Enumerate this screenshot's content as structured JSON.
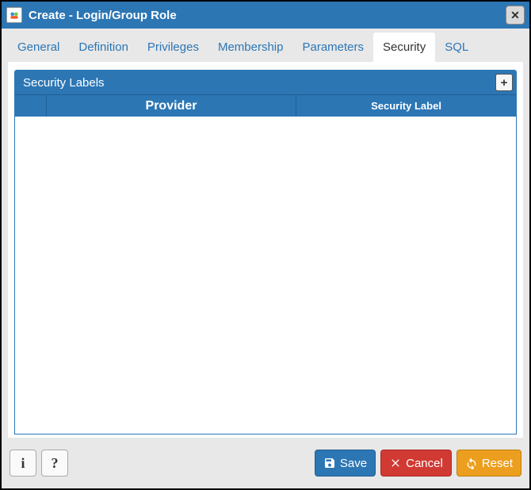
{
  "window": {
    "title": "Create - Login/Group Role"
  },
  "tabs": [
    {
      "label": "General",
      "active": false
    },
    {
      "label": "Definition",
      "active": false
    },
    {
      "label": "Privileges",
      "active": false
    },
    {
      "label": "Membership",
      "active": false
    },
    {
      "label": "Parameters",
      "active": false
    },
    {
      "label": "Security",
      "active": true
    },
    {
      "label": "SQL",
      "active": false
    }
  ],
  "panel": {
    "title": "Security Labels",
    "add_tooltip": "+",
    "columns": [
      "",
      "Provider",
      "Security Label"
    ],
    "rows": []
  },
  "footer": {
    "info": "i",
    "help": "?",
    "save": "Save",
    "cancel": "Cancel",
    "reset": "Reset"
  }
}
